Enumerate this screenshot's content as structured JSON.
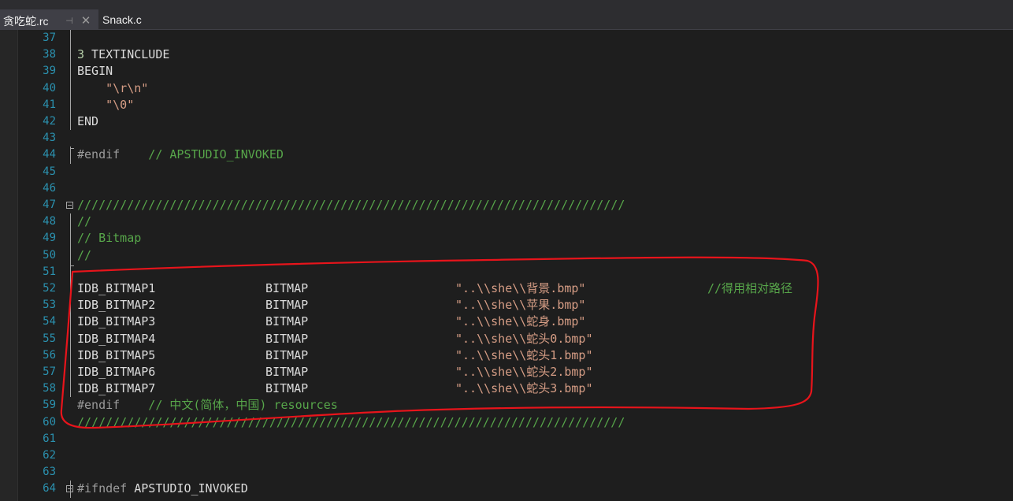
{
  "tabs": [
    {
      "label": "贪吃蛇.rc",
      "active": true,
      "pin_glyph": "⊣",
      "close_glyph": "✕"
    },
    {
      "label": "Snack.c",
      "active": false
    }
  ],
  "editor": {
    "lines": [
      {
        "n": "37",
        "parts": []
      },
      {
        "n": "38",
        "parts": [
          {
            "t": "3",
            "c": "c-num"
          },
          {
            "t": " TEXTINCLUDE",
            "c": "c-kw"
          }
        ]
      },
      {
        "n": "39",
        "parts": [
          {
            "t": "BEGIN",
            "c": "c-kw"
          }
        ]
      },
      {
        "n": "40",
        "parts": [
          {
            "t": "    \"\\r\\n\"",
            "c": "c-str"
          }
        ]
      },
      {
        "n": "41",
        "parts": [
          {
            "t": "    \"\\0\"",
            "c": "c-str"
          }
        ]
      },
      {
        "n": "42",
        "parts": [
          {
            "t": "END",
            "c": "c-kw"
          }
        ]
      },
      {
        "n": "43",
        "parts": []
      },
      {
        "n": "44",
        "parts": [
          {
            "t": "#endif",
            "c": "c-pre"
          },
          {
            "t": "    // APSTUDIO_INVOKED",
            "c": "c-com"
          }
        ]
      },
      {
        "n": "45",
        "parts": []
      },
      {
        "n": "46",
        "parts": []
      },
      {
        "n": "47",
        "parts": [
          {
            "t": "/////////////////////////////////////////////////////////////////////////////",
            "c": "c-com"
          }
        ]
      },
      {
        "n": "48",
        "parts": [
          {
            "t": "//",
            "c": "c-com"
          }
        ]
      },
      {
        "n": "49",
        "parts": [
          {
            "t": "// Bitmap",
            "c": "c-com"
          }
        ]
      },
      {
        "n": "50",
        "parts": [
          {
            "t": "//",
            "c": "c-com"
          }
        ]
      },
      {
        "n": "51",
        "parts": []
      },
      {
        "n": "52",
        "id": "IDB_BITMAP1",
        "type": "BITMAP",
        "path": "\"..\\\\she\\\\背景.bmp\"",
        "note": "//得用相对路径"
      },
      {
        "n": "53",
        "id": "IDB_BITMAP2",
        "type": "BITMAP",
        "path": "\"..\\\\she\\\\苹果.bmp\""
      },
      {
        "n": "54",
        "id": "IDB_BITMAP3",
        "type": "BITMAP",
        "path": "\"..\\\\she\\\\蛇身.bmp\""
      },
      {
        "n": "55",
        "id": "IDB_BITMAP4",
        "type": "BITMAP",
        "path": "\"..\\\\she\\\\蛇头0.bmp\""
      },
      {
        "n": "56",
        "id": "IDB_BITMAP5",
        "type": "BITMAP",
        "path": "\"..\\\\she\\\\蛇头1.bmp\""
      },
      {
        "n": "57",
        "id": "IDB_BITMAP6",
        "type": "BITMAP",
        "path": "\"..\\\\she\\\\蛇头2.bmp\""
      },
      {
        "n": "58",
        "id": "IDB_BITMAP7",
        "type": "BITMAP",
        "path": "\"..\\\\she\\\\蛇头3.bmp\""
      },
      {
        "n": "59",
        "parts": [
          {
            "t": "#endif",
            "c": "c-pre"
          },
          {
            "t": "    // 中文(简体，中国) resources",
            "c": "c-com"
          }
        ]
      },
      {
        "n": "60",
        "parts": [
          {
            "t": "/////////////////////////////////////////////////////////////////////////////",
            "c": "c-com"
          }
        ]
      },
      {
        "n": "61",
        "parts": []
      },
      {
        "n": "62",
        "parts": []
      },
      {
        "n": "63",
        "parts": []
      },
      {
        "n": "64",
        "parts": [
          {
            "t": "#ifndef",
            "c": "c-pre"
          },
          {
            "t": " APSTUDIO_INVOKED",
            "c": "c-kw"
          }
        ]
      }
    ]
  },
  "colors": {
    "annotation": "#e8141b"
  }
}
